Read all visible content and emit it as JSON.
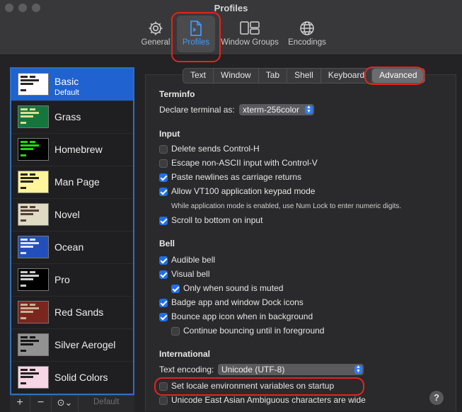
{
  "window": {
    "title": "Profiles"
  },
  "toolbar": {
    "items": [
      {
        "label": "General",
        "icon": "gear-icon"
      },
      {
        "label": "Profiles",
        "icon": "document-icon"
      },
      {
        "label": "Window Groups",
        "icon": "window-groups-icon"
      },
      {
        "label": "Encodings",
        "icon": "globe-icon"
      }
    ],
    "selected": "Profiles"
  },
  "profiles": {
    "items": [
      {
        "name": "Basic",
        "subtitle": "Default",
        "thumb_bg": "#ffffff",
        "thumb_fg": "#000000"
      },
      {
        "name": "Grass",
        "thumb_bg": "#13773d",
        "thumb_fg": "#fff0a5"
      },
      {
        "name": "Homebrew",
        "thumb_bg": "#000000",
        "thumb_fg": "#28fe14"
      },
      {
        "name": "Man Page",
        "thumb_bg": "#fef49c",
        "thumb_fg": "#000000"
      },
      {
        "name": "Novel",
        "thumb_bg": "#dfdbc3",
        "thumb_fg": "#3b2322"
      },
      {
        "name": "Ocean",
        "thumb_bg": "#224fbc",
        "thumb_fg": "#ffffff"
      },
      {
        "name": "Pro",
        "thumb_bg": "#000000",
        "thumb_fg": "#f2f2f2"
      },
      {
        "name": "Red Sands",
        "thumb_bg": "#7a251e",
        "thumb_fg": "#d7c9a7"
      },
      {
        "name": "Silver Aerogel",
        "thumb_bg": "#929292",
        "thumb_fg": "#000000"
      },
      {
        "name": "Solid Colors",
        "thumb_bg": "#f6d5e4",
        "thumb_fg": "#000000"
      }
    ],
    "selected": "Basic"
  },
  "sidebar_tools": {
    "add": "+",
    "remove": "−",
    "more": "⊙⌄",
    "default_label": "Default"
  },
  "tabs": {
    "items": [
      "Text",
      "Window",
      "Tab",
      "Shell",
      "Keyboard",
      "Advanced"
    ],
    "selected": "Advanced"
  },
  "terminfo": {
    "heading": "Terminfo",
    "declare_label": "Declare terminal as:",
    "declare_value": "xterm-256color"
  },
  "input": {
    "heading": "Input",
    "delete_sends_ctrl_h": {
      "label": "Delete sends Control-H",
      "checked": false
    },
    "escape_non_ascii": {
      "label": "Escape non-ASCII input with Control-V",
      "checked": false
    },
    "paste_newlines": {
      "label": "Paste newlines as carriage returns",
      "checked": true
    },
    "allow_vt100": {
      "label": "Allow VT100 application keypad mode",
      "checked": true
    },
    "vt100_note": "While application mode is enabled, use Num Lock to enter numeric digits.",
    "scroll_to_bottom": {
      "label": "Scroll to bottom on input",
      "checked": true
    }
  },
  "bell": {
    "heading": "Bell",
    "audible": {
      "label": "Audible bell",
      "checked": true
    },
    "visual": {
      "label": "Visual bell",
      "checked": true
    },
    "only_when_muted": {
      "label": "Only when sound is muted",
      "checked": true
    },
    "badge_dock": {
      "label": "Badge app and window Dock icons",
      "checked": true
    },
    "bounce_icon": {
      "label": "Bounce app icon when in background",
      "checked": true
    },
    "continue_bouncing": {
      "label": "Continue bouncing until in foreground",
      "checked": false
    }
  },
  "international": {
    "heading": "International",
    "encoding_label": "Text encoding:",
    "encoding_value": "Unicode (UTF-8)",
    "set_locale": {
      "label": "Set locale environment variables on startup",
      "checked": false
    },
    "east_asian": {
      "label": "Unicode East Asian Ambiguous characters are wide",
      "checked": false
    }
  },
  "help": "?",
  "colors": {
    "accent": "#1f6fe8",
    "highlight_ring": "#e5241c",
    "selection": "#1f62d0"
  }
}
